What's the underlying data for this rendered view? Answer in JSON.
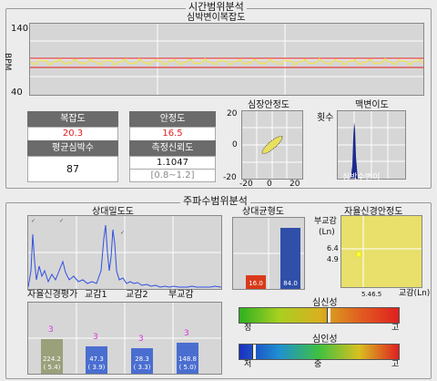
{
  "time_section": {
    "title": "시간범위분석",
    "hr_chart_title": "심박변이복잡도",
    "y_max": "140",
    "y_min": "40",
    "y_unit": "BPM",
    "complexity": {
      "label": "복잡도",
      "value": "20.3"
    },
    "stability": {
      "label": "안정도",
      "value": "16.5"
    },
    "avg_hr": {
      "label": "평균심박수",
      "value": "87"
    },
    "reliability": {
      "label": "측정신뢰도",
      "value": "1.1047",
      "range": "[0.8~1.2]"
    },
    "poincare": {
      "title": "심장안정도",
      "y_ticks": [
        "20",
        "0",
        "-20"
      ],
      "x_ticks": [
        "-20",
        "0",
        "20"
      ]
    },
    "pulse_var": {
      "title": "맥변이도",
      "y_label": "횟수",
      "x_label": "심박수변이"
    }
  },
  "freq_section": {
    "title": "주파수범위분석",
    "density": {
      "title": "상대밀도도"
    },
    "balance": {
      "title": "상대균형도",
      "left_value": "16.0",
      "right_value": "84.0"
    },
    "ans_stability": {
      "title": "자율신경안정도",
      "y_label_1": "부교감",
      "y_label_2": "(Ln)",
      "y_tick_1": "6.4",
      "y_tick_2": "4.9",
      "x_label": "교감(Ln)",
      "x_ticks": "5.46.5"
    },
    "ans_eval": {
      "title": "자율신경평가",
      "labels": [
        "교감1",
        "교감2",
        "부교감"
      ],
      "bars": [
        {
          "value": "224.2",
          "sub": "( 5.4)"
        },
        {
          "value": "47.3",
          "sub": "( 3.9)"
        },
        {
          "value": "28.3",
          "sub": "( 3.3)"
        },
        {
          "value": "148.8",
          "sub": "( 5.0)"
        }
      ]
    },
    "mental_stress": {
      "title": "심신성",
      "left": "정",
      "right": "고"
    },
    "mind_stability": {
      "title": "심인성",
      "left": "저",
      "mid": "중",
      "right": "고"
    }
  }
}
